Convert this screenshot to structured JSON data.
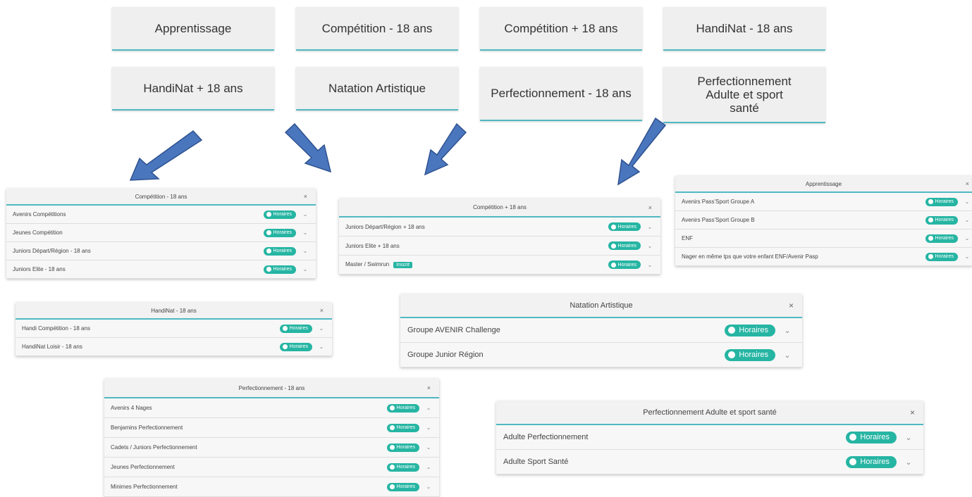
{
  "categories": [
    "Apprentissage",
    "Compétition - 18 ans",
    "Compétition + 18 ans",
    "HandiNat - 18 ans",
    "HandiNat + 18 ans",
    "Natation Artistique",
    "Perfectionnement - 18 ans",
    "Perfectionnement Adulte et sport santé"
  ],
  "common": {
    "badge": "Horaires",
    "close": "×",
    "chevron": "⌄",
    "inscrit": "Inscrit"
  },
  "panels": {
    "comp_minus": {
      "title": "Compétition - 18 ans",
      "rows": [
        "Avenirs Compétitions",
        "Jeunes Compétition",
        "Juniors Départ/Région - 18 ans",
        "Juniors Elite - 18 ans"
      ]
    },
    "comp_plus": {
      "title": "Compétition + 18 ans",
      "rows": [
        "Juniors Départ/Région + 18 ans",
        "Juniors Elite + 18 ans",
        "Master / Swimrun"
      ]
    },
    "apprentissage": {
      "title": "Apprentissage",
      "rows": [
        "Avenirs Pass'Sport Groupe A",
        "Avenirs Pass'Sport Groupe B",
        "ENF",
        "Nager en même tps que votre enfant ENF/Avenir Pasp"
      ]
    },
    "handinat_minus": {
      "title": "HandiNat - 18 ans",
      "rows": [
        "Handi Compétition - 18 ans",
        "HandiNat Loisir - 18 ans"
      ]
    },
    "natation_artistique": {
      "title": "Natation Artistique",
      "rows": [
        "Groupe AVENIR Challenge",
        "Groupe Junior Région"
      ]
    },
    "perf_minus": {
      "title": "Perfectionnement - 18 ans",
      "rows": [
        "Avenirs 4 Nages",
        "Benjamins Perfectionnement",
        "Cadets / Juniors Perfectionnement",
        "Jeunes Perfectionnement",
        "Minimes Perfectionnement"
      ]
    },
    "perf_adulte": {
      "title": "Perfectionnement Adulte et sport santé",
      "rows": [
        "Adulte Perfectionnement",
        "Adulte Sport Santé"
      ]
    }
  },
  "colors": {
    "accent": "#4fb8c2",
    "badge": "#26b5a3",
    "arrow_fill": "#4a76be",
    "arrow_stroke": "#2f528f"
  }
}
